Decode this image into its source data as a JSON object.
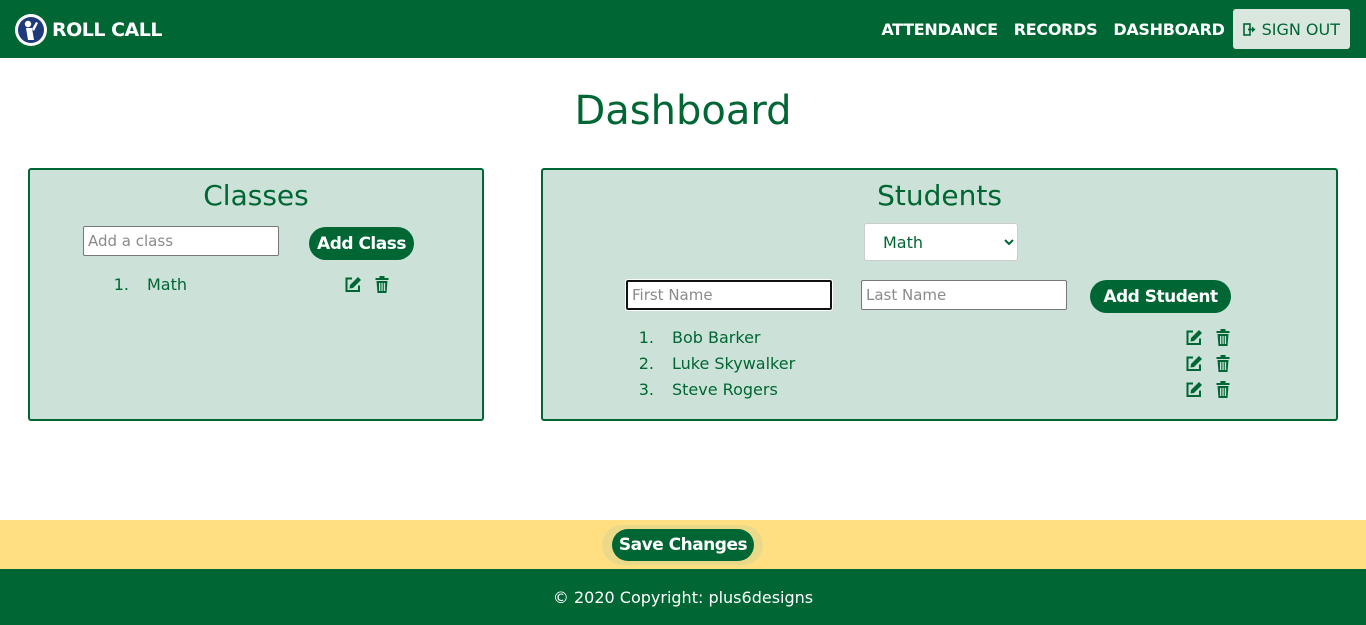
{
  "brand": {
    "name": "ROLL CALL"
  },
  "nav": {
    "links": [
      "ATTENDANCE",
      "RECORDS",
      "DASHBOARD"
    ],
    "sign_out": "SIGN OUT"
  },
  "page": {
    "title": "Dashboard"
  },
  "classes": {
    "title": "Classes",
    "input_placeholder": "Add a class",
    "add_button": "Add Class",
    "items": [
      {
        "num": "1.",
        "name": "Math"
      }
    ]
  },
  "students": {
    "title": "Students",
    "selected_class": "Math",
    "first_name_placeholder": "First Name",
    "last_name_placeholder": "Last Name",
    "add_button": "Add Student",
    "items": [
      {
        "num": "1.",
        "name": "Bob Barker"
      },
      {
        "num": "2.",
        "name": "Luke Skywalker"
      },
      {
        "num": "3.",
        "name": "Steve Rogers"
      }
    ]
  },
  "save": {
    "label": "Save Changes"
  },
  "footer": {
    "text": "© 2020 Copyright: plus6designs"
  },
  "icons": {
    "edit": "edit-icon",
    "delete": "trash-icon",
    "sign_out": "sign-out-icon",
    "logo": "roll-call-logo"
  },
  "colors": {
    "primary": "#006633",
    "panel_bg": "#cce2d8",
    "save_bar": "#ffdf82"
  }
}
